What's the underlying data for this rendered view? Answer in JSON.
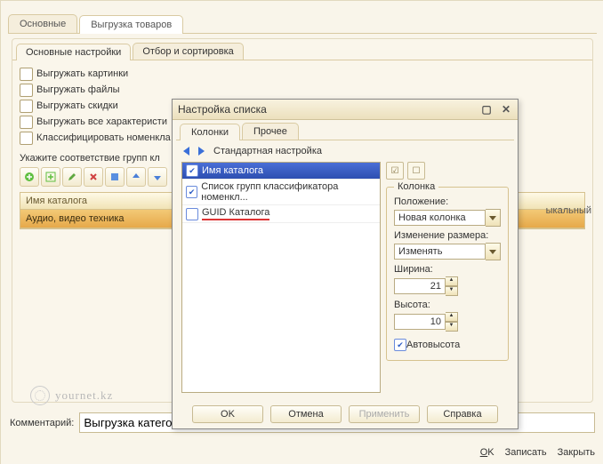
{
  "outerTabs": [
    "Основные",
    "Выгрузка товаров"
  ],
  "innerTabs": [
    "Основные настройки",
    "Отбор и сортировка"
  ],
  "checks": [
    "Выгружать картинки",
    "Выгружать файлы",
    "Выгружать скидки",
    "Выгружать все характеристи",
    "Классифицировать номенкла"
  ],
  "groupLabel": "Укажите соответствие групп кл",
  "grid": {
    "header": "Имя каталога",
    "row0": "Аудио, видео техника"
  },
  "hiddenCol": "ыкальный",
  "watermark": "yournet.kz",
  "commentLabel": "Комментарий:",
  "commentValue": "Выгрузка категори",
  "footer": {
    "ok_u": "O",
    "ok_r": "K",
    "write": "Записать",
    "close": "Закрыть"
  },
  "dialog": {
    "title": "Настройка списка",
    "tabs": [
      "Колонки",
      "Прочее"
    ],
    "defaultLink": "Стандартная настройка",
    "columns": [
      "Имя каталога",
      "Список групп классификатора номенкл...",
      "GUID Каталога"
    ],
    "groupTitle": "Колонка",
    "posLabel": "Положение:",
    "posValue": "Новая колонка",
    "resizeLabel": "Изменение размера:",
    "resizeValue": "Изменять",
    "widthLabel": "Ширина:",
    "widthValue": "21",
    "heightLabel": "Высота:",
    "heightValue": "10",
    "autoHeight": "Автовысота",
    "buttons": {
      "ok": "OK",
      "cancel": "Отмена",
      "apply": "Применить",
      "help": "Справка"
    }
  }
}
